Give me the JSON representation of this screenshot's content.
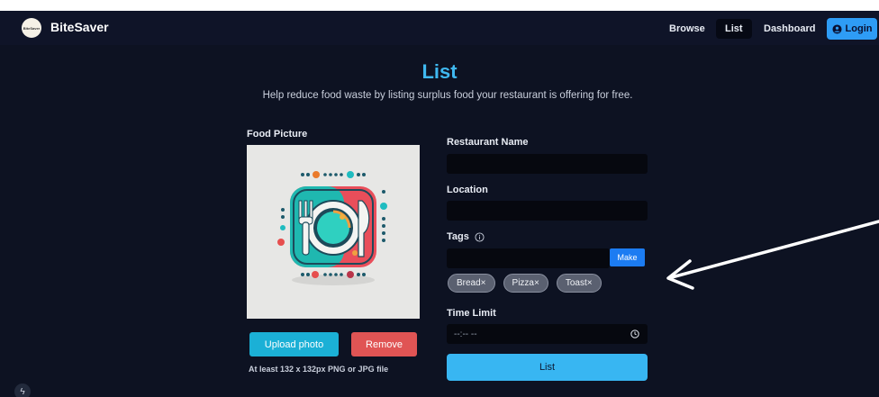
{
  "nav": {
    "brand": "BiteSaver",
    "logo_text": "BiteSaver",
    "links": [
      "Browse",
      "List",
      "Dashboard"
    ],
    "login": "Login",
    "active_link": "List"
  },
  "header": {
    "title": "List",
    "subtitle": "Help reduce food waste by listing surplus food your restaurant is offering for free."
  },
  "left": {
    "food_picture_label": "Food Picture",
    "upload_button": "Upload photo",
    "remove_button": "Remove",
    "hint": "At least 132 x 132px PNG or JPG file"
  },
  "form": {
    "restaurant_label": "Restaurant Name",
    "restaurant_value": "",
    "location_label": "Location",
    "location_value": "",
    "tags_label": "Tags",
    "tags_input_value": "",
    "make_button": "Make",
    "tags": [
      "Bread×",
      "Pizza×",
      "Toast×"
    ],
    "time_label": "Time Limit",
    "time_value": "--:-- --",
    "submit": "List"
  },
  "colors": {
    "background": "#0d1222",
    "accent": "#38b6f2",
    "login": "#2e9cf5",
    "remove": "#e05454",
    "upload": "#1bb0d6"
  },
  "icons": [
    "user-circle-icon",
    "info-icon",
    "clock-icon",
    "bolt-icon",
    "food-plate-illustration"
  ]
}
